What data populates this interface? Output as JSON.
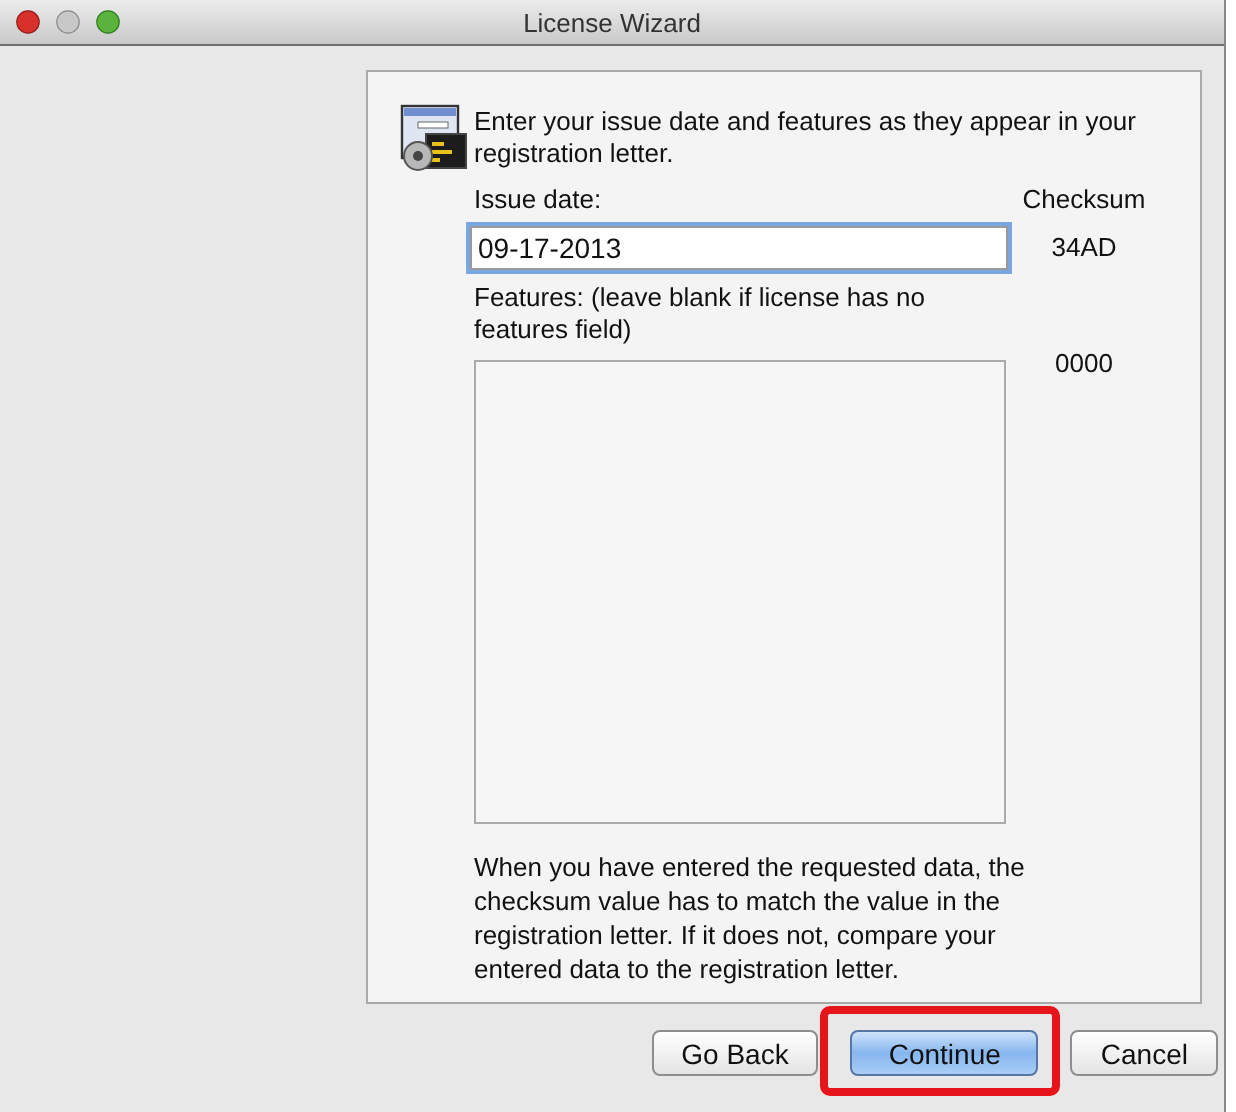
{
  "window": {
    "title": "License Wizard"
  },
  "intro": "Enter your issue date and features as they appear in your registration letter.",
  "checksum_header": "Checksum",
  "issue_date": {
    "label": "Issue date:",
    "value": "09-17-2013",
    "focused": true,
    "checksum": "34AD"
  },
  "features": {
    "label": "Features: (leave blank if license has no features field)",
    "checksum": "0000"
  },
  "note": "When you have entered the requested data, the checksum value has to match the value in the registration letter.  If it does not, compare your entered data to the registration letter.",
  "buttons": [
    {
      "label": "Go Back",
      "default": false,
      "highlighted": false
    },
    {
      "label": "Continue",
      "default": true,
      "highlighted": true
    },
    {
      "label": "Cancel",
      "default": false,
      "highlighted": false
    }
  ]
}
